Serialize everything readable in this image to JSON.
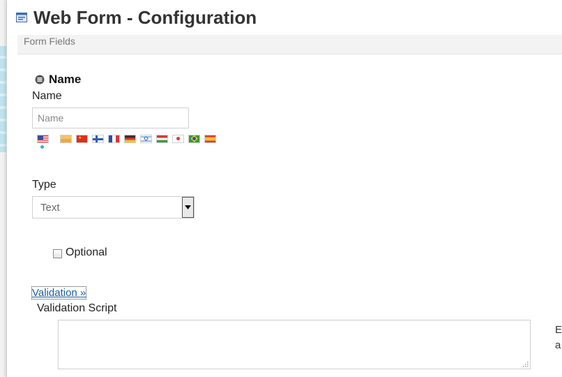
{
  "dialog": {
    "title": "Web Form - Configuration",
    "title_icon": "form-icon"
  },
  "section": {
    "label": "Form Fields"
  },
  "field": {
    "heading": "Name",
    "heading_icon": "collapse-icon",
    "name_label": "Name",
    "name_placeholder": "Name",
    "language_flags": [
      "us",
      "unknown-beige",
      "china",
      "finland",
      "france",
      "germany",
      "israel",
      "hungary",
      "japan",
      "brazil",
      "spain"
    ],
    "selected_flag": "us",
    "type_label": "Type",
    "type_value": "Text",
    "optional_label": "Optional",
    "optional_checked": false,
    "validation_link": "Validation »",
    "validation_script_label": "Validation Script",
    "side_text_line1": "E",
    "side_text_line2": "a"
  },
  "colors": {
    "title": "#333333",
    "link": "#1a5c9a",
    "section_bar": "#f3f3f3",
    "active_flag_dot": "#22b8d4"
  }
}
